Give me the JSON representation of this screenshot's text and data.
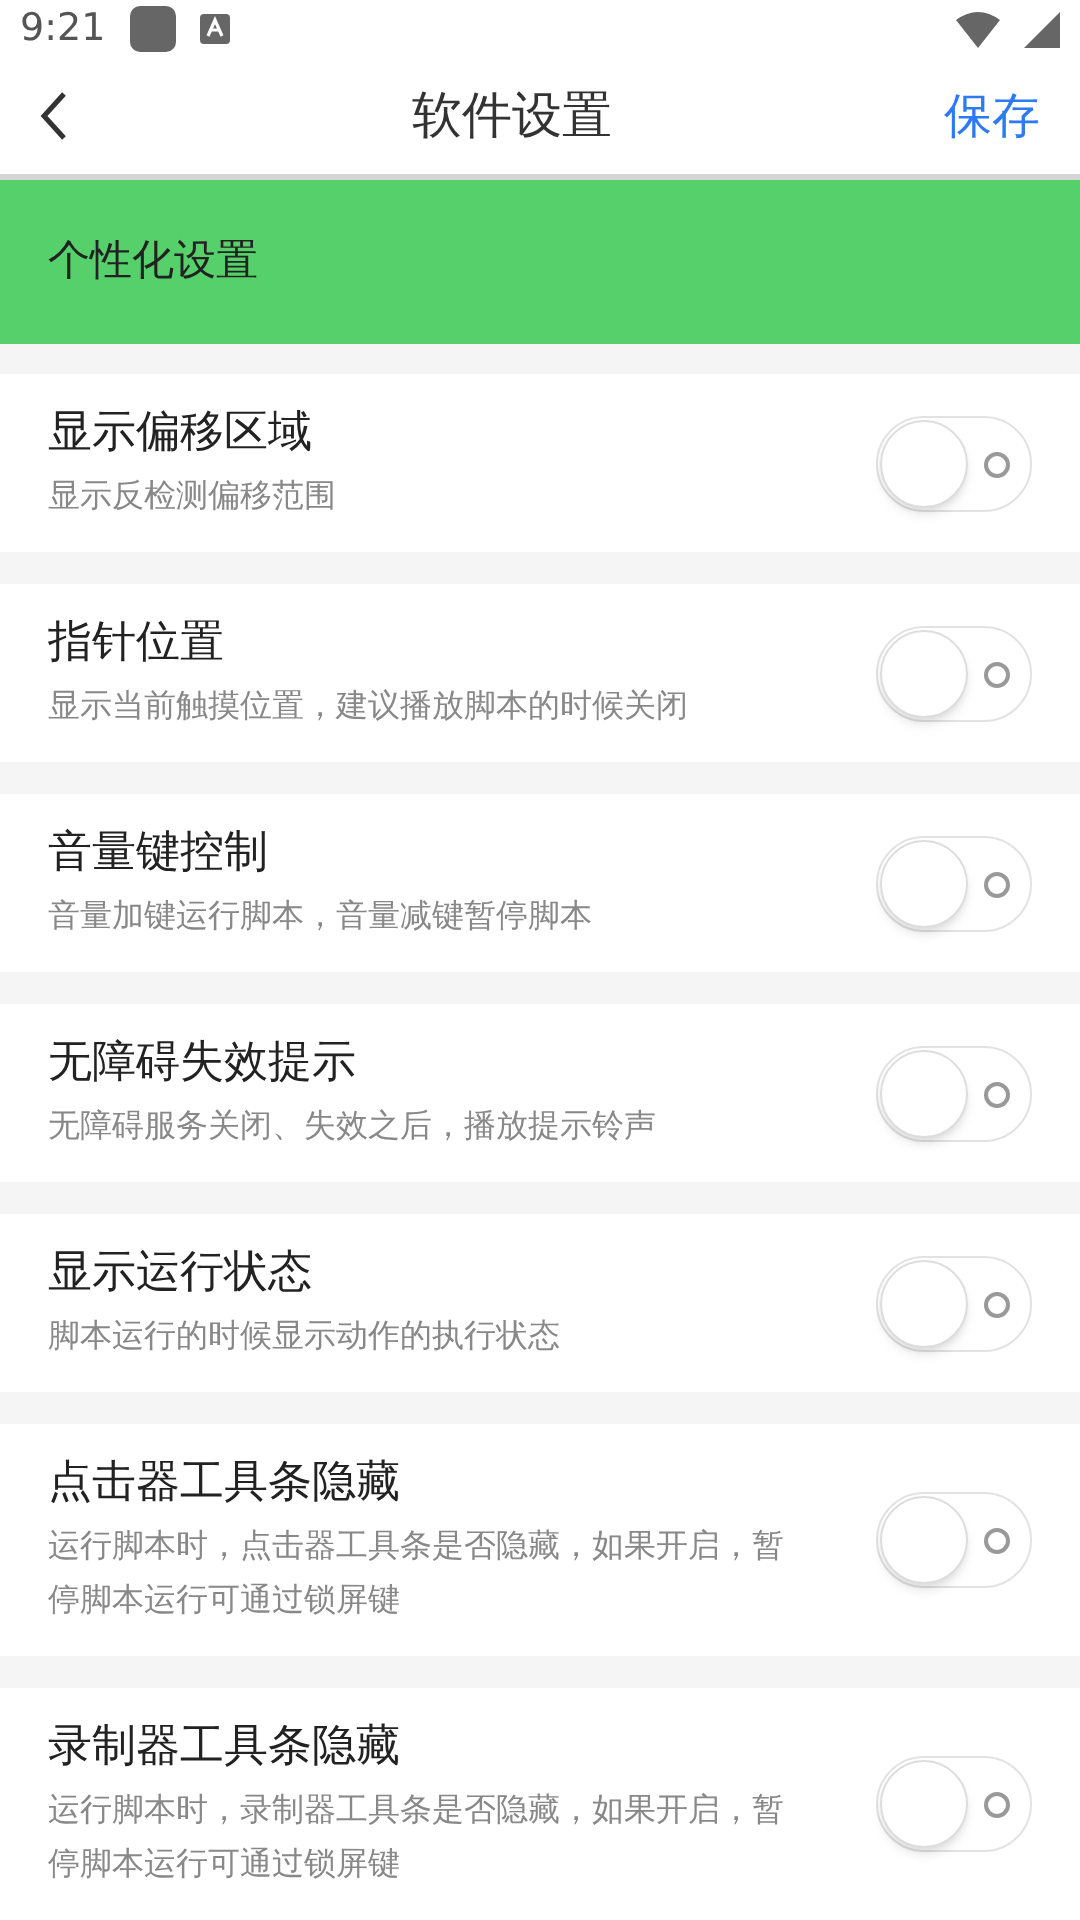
{
  "status_bar": {
    "time": "9:21"
  },
  "header": {
    "title": "软件设置",
    "save": "保存"
  },
  "section": {
    "title": "个性化设置"
  },
  "settings": [
    {
      "title": "显示偏移区域",
      "description": "显示反检测偏移范围",
      "on": false
    },
    {
      "title": "指针位置",
      "description": "显示当前触摸位置，建议播放脚本的时候关闭",
      "on": false
    },
    {
      "title": "音量键控制",
      "description": "音量加键运行脚本，音量减键暂停脚本",
      "on": false
    },
    {
      "title": "无障碍失效提示",
      "description": "无障碍服务关闭、失效之后，播放提示铃声",
      "on": false
    },
    {
      "title": "显示运行状态",
      "description": "脚本运行的时候显示动作的执行状态",
      "on": false
    },
    {
      "title": "点击器工具条隐藏",
      "description": "运行脚本时，点击器工具条是否隐藏，如果开启，暂停脚本运行可通过锁屏键",
      "on": false
    },
    {
      "title": "录制器工具条隐藏",
      "description": "运行脚本时，录制器工具条是否隐藏，如果开启，暂停脚本运行可通过锁屏键",
      "on": false
    }
  ]
}
